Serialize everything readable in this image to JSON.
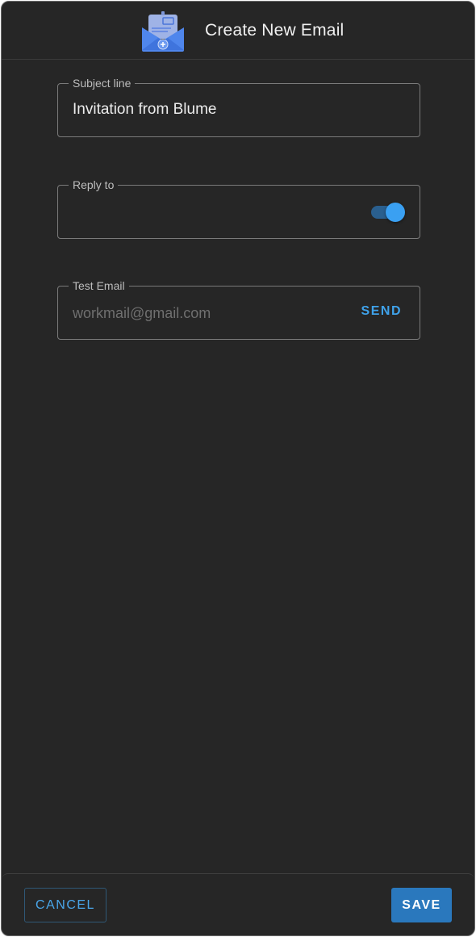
{
  "header": {
    "title": "Create New Email",
    "icon": "email-open-plus-icon"
  },
  "fields": {
    "subject": {
      "label": "Subject line",
      "value": "Invitation from Blume"
    },
    "reply_to": {
      "label": "Reply to",
      "toggle_on": true
    },
    "test_email": {
      "label": "Test Email",
      "value": "",
      "placeholder": "workmail@gmail.com",
      "send_label": "SEND"
    }
  },
  "footer": {
    "cancel_label": "CANCEL",
    "save_label": "SAVE"
  },
  "colors": {
    "background": "#262626",
    "accent": "#3fa2ea",
    "primary_button": "#2a78bd"
  }
}
